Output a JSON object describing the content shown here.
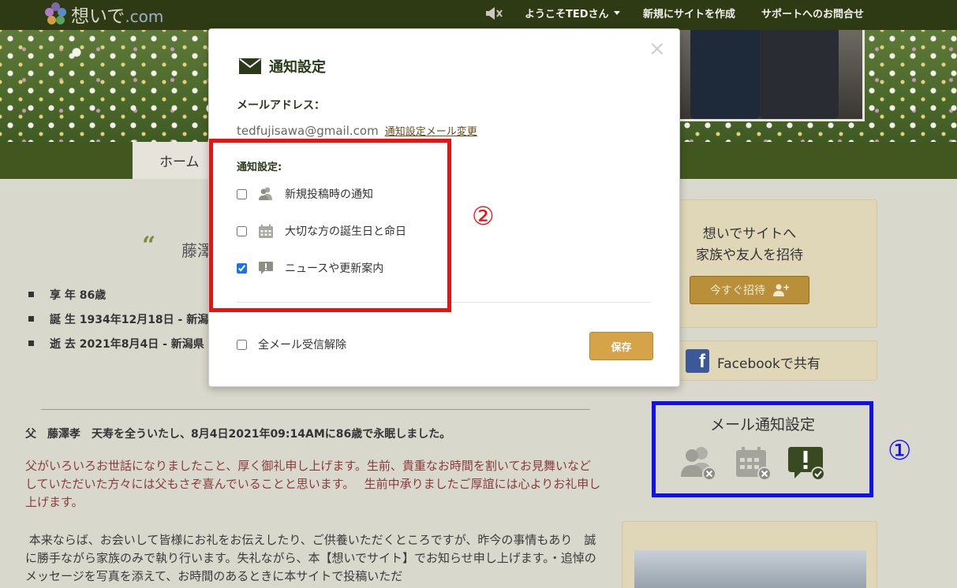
{
  "topbar": {
    "logo_text": "想いで",
    "logo_domain": ".com",
    "greeting": "ようこそTEDさん",
    "create_site": "新規にサイトを作成",
    "support": "サポートへのお問合せ"
  },
  "mainnav": {
    "home": "ホーム"
  },
  "profile": {
    "quote_name": "藤澤",
    "info": [
      "享 年 86歳",
      "誕 生 1934年12月18日 - 新潟",
      "逝 去 2021年8月4日 - 新潟県"
    ],
    "headline": "父　藤澤孝　天寿を全ういたし、8月4日2021年09:14AMに86歳で永眠しました。",
    "para_red": "父がいろいろお世話になりましたこと、厚く御礼申し上げます。生前、貴重なお時間を割いてお見舞いなどしていただいた方々には父もさぞ喜んでいることと思います。　 生前中承りましたご厚誼には心よりお礼申し上げます。",
    "para_dark": "本来ならば、お会いして皆様にお礼をお伝えしたり、ご供養いただくところですが、昨今の事情もあり　誠に勝手ながら家族のみで執り行います。失礼ながら、本【想いでサイト】でお知らせ申し上げます。・追悼のメッセージを写真を添えて、お時間のあるときに本サイトで投稿いただ"
  },
  "sidebar": {
    "invite_line1": "想いでサイトへ",
    "invite_line2": "家族や友人を招待",
    "invite_button": "今すぐ招待",
    "facebook_share": "Facebookで共有",
    "mail_settings_title": "メール通知設定"
  },
  "annotations": {
    "circle_1": "①",
    "circle_2": "②"
  },
  "modal": {
    "title": "通知設定",
    "close": "×",
    "email_label": "メールアドレス：",
    "email_value": "tedfujisawa@gmail.com",
    "email_change_link": "通知設定メール変更",
    "notify_label": "通知設定:",
    "options": [
      {
        "label": "新規投稿時の通知",
        "checked": false,
        "icon": "users-icon"
      },
      {
        "label": "大切な方の誕生日と命日",
        "checked": false,
        "icon": "calendar-icon"
      },
      {
        "label": "ニュースや更新案内",
        "checked": true,
        "icon": "news-alert-icon"
      }
    ],
    "unsubscribe_all": "全メール受信解除",
    "unsubscribe_checked": false,
    "save": "保存"
  },
  "colors": {
    "topbar": "#2e3a14",
    "nav": "#42561f",
    "accent_gold": "#d5a348",
    "annotation_red": "#ee1010",
    "annotation_blue": "#1010ee"
  }
}
